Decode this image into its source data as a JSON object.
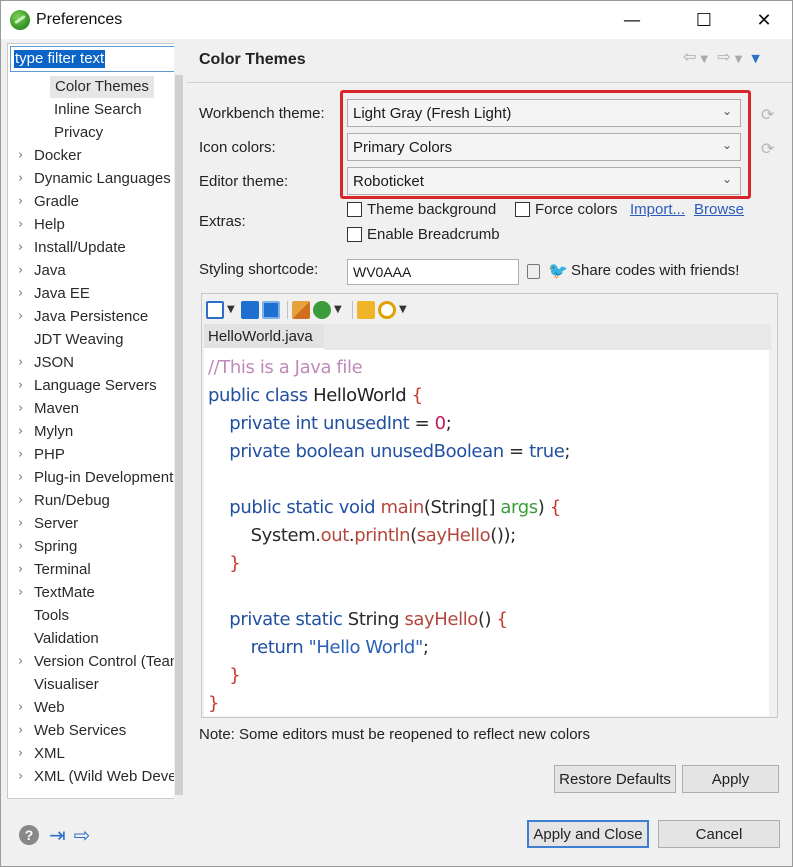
{
  "window": {
    "title": "Preferences",
    "minimize": "—",
    "maximize": "☐",
    "close": "✕"
  },
  "sidebar": {
    "filter_text": "type filter text",
    "items": [
      {
        "label": "Color Themes",
        "indent": 2,
        "expandable": false,
        "selected": true
      },
      {
        "label": "Inline Search",
        "indent": 2,
        "expandable": false
      },
      {
        "label": "Privacy",
        "indent": 2,
        "expandable": false
      },
      {
        "label": "Docker",
        "indent": 1,
        "expandable": true
      },
      {
        "label": "Dynamic Languages",
        "indent": 1,
        "expandable": true
      },
      {
        "label": "Gradle",
        "indent": 1,
        "expandable": true
      },
      {
        "label": "Help",
        "indent": 1,
        "expandable": true
      },
      {
        "label": "Install/Update",
        "indent": 1,
        "expandable": true
      },
      {
        "label": "Java",
        "indent": 1,
        "expandable": true
      },
      {
        "label": "Java EE",
        "indent": 1,
        "expandable": true
      },
      {
        "label": "Java Persistence",
        "indent": 1,
        "expandable": true
      },
      {
        "label": "JDT Weaving",
        "indent": 1,
        "expandable": false
      },
      {
        "label": "JSON",
        "indent": 1,
        "expandable": true
      },
      {
        "label": "Language Servers",
        "indent": 1,
        "expandable": true
      },
      {
        "label": "Maven",
        "indent": 1,
        "expandable": true
      },
      {
        "label": "Mylyn",
        "indent": 1,
        "expandable": true
      },
      {
        "label": "PHP",
        "indent": 1,
        "expandable": true
      },
      {
        "label": "Plug-in Development",
        "indent": 1,
        "expandable": true
      },
      {
        "label": "Run/Debug",
        "indent": 1,
        "expandable": true
      },
      {
        "label": "Server",
        "indent": 1,
        "expandable": true
      },
      {
        "label": "Spring",
        "indent": 1,
        "expandable": true
      },
      {
        "label": "Terminal",
        "indent": 1,
        "expandable": true
      },
      {
        "label": "TextMate",
        "indent": 1,
        "expandable": true
      },
      {
        "label": "Tools",
        "indent": 1,
        "expandable": false
      },
      {
        "label": "Validation",
        "indent": 1,
        "expandable": false
      },
      {
        "label": "Version Control (Team)",
        "indent": 1,
        "expandable": true
      },
      {
        "label": "Visualiser",
        "indent": 1,
        "expandable": false
      },
      {
        "label": "Web",
        "indent": 1,
        "expandable": true
      },
      {
        "label": "Web Services",
        "indent": 1,
        "expandable": true
      },
      {
        "label": "XML",
        "indent": 1,
        "expandable": true
      },
      {
        "label": "XML (Wild Web Developer)",
        "indent": 1,
        "expandable": true
      }
    ]
  },
  "page": {
    "title": "Color Themes",
    "workbench_theme_label": "Workbench theme:",
    "workbench_theme_value": "Light Gray (Fresh Light)",
    "icon_colors_label": "Icon colors:",
    "icon_colors_value": "Primary Colors",
    "editor_theme_label": "Editor theme:",
    "editor_theme_value": "Roboticket",
    "extras_label": "Extras:",
    "theme_background": "Theme background",
    "force_colors": "Force colors",
    "import_link": "Import...",
    "browse_link": "Browse",
    "enable_breadcrumb": "Enable Breadcrumb",
    "styling_shortcode_label": "Styling shortcode:",
    "styling_shortcode_value": "WV0AAA",
    "share_text": "Share codes with friends!",
    "tab_label": "HelloWorld.java",
    "note": "Note: Some editors must be reopened to reflect new colors"
  },
  "code": [
    [
      {
        "t": "//This is a Java file",
        "c": "cm"
      }
    ],
    [
      {
        "t": "public class ",
        "c": "kw"
      },
      {
        "t": "HelloWorld ",
        "c": "id"
      },
      {
        "t": "{",
        "c": "br"
      }
    ],
    [
      {
        "t": "    private int ",
        "c": "kw"
      },
      {
        "t": "unusedInt",
        "c": "kw"
      },
      {
        "t": " = ",
        "c": "plain"
      },
      {
        "t": "0",
        "c": "num"
      },
      {
        "t": ";",
        "c": "plain"
      }
    ],
    [
      {
        "t": "    private boolean ",
        "c": "kw"
      },
      {
        "t": "unusedBoolean",
        "c": "kw"
      },
      {
        "t": " = ",
        "c": "plain"
      },
      {
        "t": "true",
        "c": "kw"
      },
      {
        "t": ";",
        "c": "plain"
      }
    ],
    [
      {
        "t": "",
        "c": "plain"
      }
    ],
    [
      {
        "t": "    public static void ",
        "c": "kw"
      },
      {
        "t": "main",
        "c": "fn"
      },
      {
        "t": "(String[] ",
        "c": "plain"
      },
      {
        "t": "args",
        "c": "arg"
      },
      {
        "t": ") ",
        "c": "plain"
      },
      {
        "t": "{",
        "c": "br"
      }
    ],
    [
      {
        "t": "        System.",
        "c": "plain"
      },
      {
        "t": "out",
        "c": "fld"
      },
      {
        "t": ".",
        "c": "plain"
      },
      {
        "t": "println",
        "c": "fn"
      },
      {
        "t": "(",
        "c": "plain"
      },
      {
        "t": "sayHello",
        "c": "fn"
      },
      {
        "t": "());",
        "c": "plain"
      }
    ],
    [
      {
        "t": "    }",
        "c": "br"
      }
    ],
    [
      {
        "t": "",
        "c": "plain"
      }
    ],
    [
      {
        "t": "    private static ",
        "c": "kw"
      },
      {
        "t": "String ",
        "c": "plain"
      },
      {
        "t": "sayHello",
        "c": "fn"
      },
      {
        "t": "() ",
        "c": "plain"
      },
      {
        "t": "{",
        "c": "br"
      }
    ],
    [
      {
        "t": "        return ",
        "c": "kw"
      },
      {
        "t": "\"Hello World\"",
        "c": "str"
      },
      {
        "t": ";",
        "c": "plain"
      }
    ],
    [
      {
        "t": "    }",
        "c": "br"
      }
    ],
    [
      {
        "t": "}",
        "c": "br"
      }
    ]
  ],
  "buttons": {
    "restore_defaults": "Restore Defaults",
    "apply": "Apply",
    "apply_and_close": "Apply and Close",
    "cancel": "Cancel"
  },
  "colors": {
    "highlight": "#d9262b",
    "accent": "#0a64c8",
    "link": "#2d5bbd"
  }
}
